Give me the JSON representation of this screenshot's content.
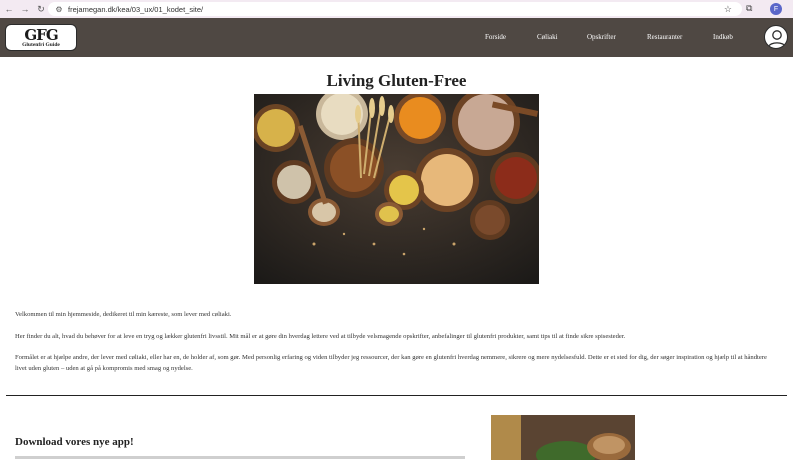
{
  "browser": {
    "url": "frejamegan.dk/kea/03_ux/01_kodet_site/",
    "profile_initial": "F"
  },
  "logo": {
    "mark": "GFG",
    "subtitle": "Glutenfri Guide"
  },
  "nav": {
    "items": [
      "Forside",
      "Cøliaki",
      "Opskrifter",
      "Restauranter",
      "Indkøb"
    ]
  },
  "main": {
    "title": "Living Gluten-Free",
    "paragraphs": [
      "Velkommen til min hjemmeside, dedikeret til min kæreste, som lever med cøliaki.",
      "Her finder du alt, hvad du behøver for at leve en tryg og lækker glutenfri livsstil. Mit mål er at gøre din hverdag lettere ved at tilbyde velsmagende opskrifter, anbefalinger til glutenfri produkter, samt tips til at finde sikre spisesteder.",
      "Formålet er at hjælpe andre, der lever med cøliaki, eller har en, de holder af, som gør. Med personlig erfaring og viden tilbyder jeg ressourcer, der kan gøre en glutenfri hverdag nemmere, sikrere og mere nydelsesfuld. Dette er et sted for dig, der søger inspiration og hjælp til at håndtere livet uden gluten – uden at gå på kompromis med smag og nydelse."
    ]
  },
  "app_section": {
    "title": "Download vores nye app!"
  },
  "colors": {
    "header_bg": "#4f4843",
    "browser_bar": "#f3eaf2",
    "text": "#222222"
  },
  "icons": [
    "back-icon",
    "forward-icon",
    "reload-icon",
    "site-settings-icon",
    "bookmark-star-icon",
    "extensions-icon",
    "profile-icon",
    "user-account-icon"
  ]
}
